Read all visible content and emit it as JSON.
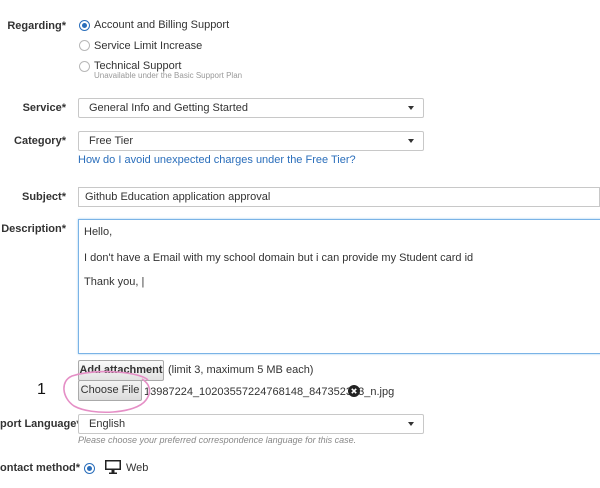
{
  "regarding": {
    "label": "Regarding*",
    "options": [
      {
        "label": "Account and Billing Support",
        "selected": true
      },
      {
        "label": "Service Limit Increase",
        "selected": false
      },
      {
        "label": "Technical Support",
        "selected": false,
        "note": "Unavailable under the Basic Support Plan"
      }
    ]
  },
  "service": {
    "label": "Service*",
    "value": "General Info and Getting Started"
  },
  "category": {
    "label": "Category*",
    "value": "Free Tier",
    "help_link": "How do I avoid unexpected charges under the Free Tier?"
  },
  "subject": {
    "label": "Subject*",
    "value": "Github Education application approval"
  },
  "description": {
    "label": "Description*",
    "lines": [
      "Hello,",
      "I don't have a Email with my school domain but i can provide my Student card id",
      "Thank you, |"
    ]
  },
  "attachment": {
    "button_label": "Add attachment",
    "limit_text": "(limit 3, maximum 5 MB each)",
    "annotation_number": "1",
    "choose_file_label": "Choose File",
    "file_name": "13987224_10203557224768148_847352383_n.jpg"
  },
  "language": {
    "label": "port Language*",
    "value": "English",
    "hint": "Please choose your preferred correspondence language for this case."
  },
  "contact": {
    "label": "ontact method*",
    "option_label": "Web"
  },
  "colors": {
    "link": "#2a6ebb",
    "annotation_circle": "#e58fc6",
    "focus_border": "#7ab3e6"
  },
  "icons": [
    "close-circle-icon",
    "monitor-icon",
    "caret-down-icon"
  ]
}
